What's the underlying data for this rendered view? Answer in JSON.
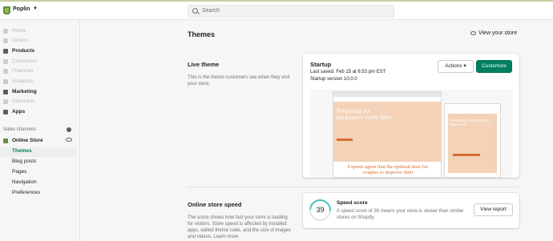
{
  "topbar": {
    "store_name": "Poplin",
    "search_placeholder": "Search"
  },
  "sidebar": {
    "items": [
      {
        "label": "Home",
        "icon": "home-icon"
      },
      {
        "label": "Orders",
        "icon": "orders-icon"
      },
      {
        "label": "Products",
        "icon": "tag-icon"
      },
      {
        "label": "Customers",
        "icon": "person-icon"
      },
      {
        "label": "Finances",
        "icon": "bank-icon"
      },
      {
        "label": "Analytics",
        "icon": "bar-chart-icon"
      },
      {
        "label": "Marketing",
        "icon": "target-icon"
      },
      {
        "label": "Discounts",
        "icon": "discount-icon"
      },
      {
        "label": "Apps",
        "icon": "apps-icon"
      }
    ],
    "sales_channels_label": "Sales channels",
    "online_store_label": "Online Store",
    "sub_items": [
      "Themes",
      "Blog posts",
      "Pages",
      "Navigation",
      "Preferences"
    ]
  },
  "main": {
    "title": "Themes",
    "view_store": "View your store",
    "live_theme": {
      "heading": "Live theme",
      "description": "This is the theme customers see when they visit your store.",
      "name": "Startup",
      "last_saved": "Last saved: Feb 15 at 6:53 pm EST",
      "version": "Startup version 10.0.0",
      "actions_label": "Actions",
      "customize_label": "Customize",
      "preview": {
        "hero_text": "Preparing for pregnancy starts here.",
        "quote_text": "Experts agree that the optimal time for couples to improve their",
        "mobile_hero_text": "Preparing for pregnancy starts here."
      }
    },
    "speed": {
      "heading": "Online store speed",
      "description": "The score shows how fast your store is loading for visitors. Store speed is affected by installed apps, edited theme code, and the size of images and videos. Learn more",
      "score": "39",
      "score_title": "Speed score",
      "score_desc": "A speed score of 39 means your store is slower than similar stores on Shopify.",
      "report_label": "View report"
    }
  },
  "colors": {
    "accent": "#008060",
    "brand": "#5e8e3e",
    "hero": "#f3d2b7",
    "hero_accent": "#d66e32",
    "gauge": "#47c1bf"
  }
}
